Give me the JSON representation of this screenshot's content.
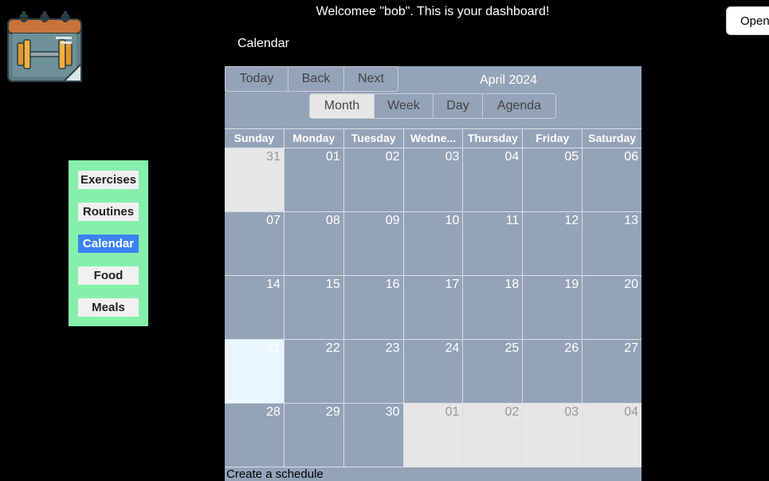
{
  "header": {
    "welcome": "Welcomee \"bob\". This is your dashboard!",
    "open_button": "Open",
    "page_title": "Calendar"
  },
  "logo": {
    "icon": "calendar-dumbbell-icon"
  },
  "nav": {
    "items": [
      {
        "label": "Exercises",
        "active": false
      },
      {
        "label": "Routines",
        "active": false
      },
      {
        "label": "Calendar",
        "active": true
      },
      {
        "label": "Food",
        "active": false
      },
      {
        "label": "Meals",
        "active": false
      }
    ]
  },
  "calendar": {
    "toolbar": {
      "today": "Today",
      "back": "Back",
      "next": "Next",
      "label": "April 2024",
      "views": [
        "Month",
        "Week",
        "Day",
        "Agenda"
      ],
      "active_view": "Month"
    },
    "weekdays": [
      "Sunday",
      "Monday",
      "Tuesday",
      "Wedne...",
      "Thursday",
      "Friday",
      "Saturday"
    ],
    "weeks": [
      [
        {
          "d": "31",
          "off": true
        },
        {
          "d": "01"
        },
        {
          "d": "02"
        },
        {
          "d": "03"
        },
        {
          "d": "04"
        },
        {
          "d": "05"
        },
        {
          "d": "06"
        }
      ],
      [
        {
          "d": "07"
        },
        {
          "d": "08"
        },
        {
          "d": "09"
        },
        {
          "d": "10"
        },
        {
          "d": "11"
        },
        {
          "d": "12"
        },
        {
          "d": "13"
        }
      ],
      [
        {
          "d": "14"
        },
        {
          "d": "15"
        },
        {
          "d": "16"
        },
        {
          "d": "17"
        },
        {
          "d": "18"
        },
        {
          "d": "19"
        },
        {
          "d": "20"
        }
      ],
      [
        {
          "d": "21",
          "today": true
        },
        {
          "d": "22"
        },
        {
          "d": "23"
        },
        {
          "d": "24"
        },
        {
          "d": "25"
        },
        {
          "d": "26"
        },
        {
          "d": "27"
        }
      ],
      [
        {
          "d": "28"
        },
        {
          "d": "29"
        },
        {
          "d": "30"
        },
        {
          "d": "01",
          "off": true
        },
        {
          "d": "02",
          "off": true
        },
        {
          "d": "03",
          "off": true
        },
        {
          "d": "04",
          "off": true
        }
      ]
    ],
    "footer_text": "Create a schedule"
  },
  "colors": {
    "background": "#000000",
    "nav_bg": "#86efac",
    "nav_active": "#3b82f6",
    "calendar_bg": "#94a3b8",
    "off_range": "#e6e6e6",
    "today": "#eaf6ff"
  }
}
